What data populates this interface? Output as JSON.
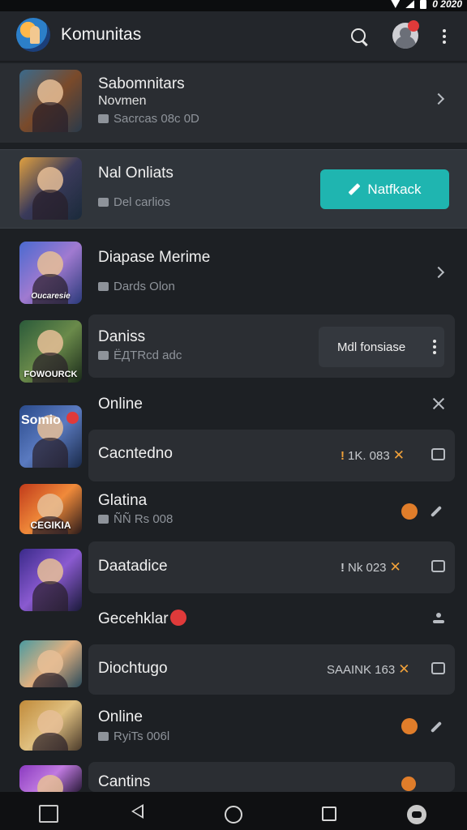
{
  "status_bar": {
    "time": "0 2020"
  },
  "header": {
    "title": "Komunitas"
  },
  "rows": [
    {
      "title": "Sabomnitars",
      "subtitle": "Novmen",
      "meta": "Sacrcas 08c 0D",
      "thumb_label": ""
    },
    {
      "title": "Nal Onliats",
      "meta": "Del carlios",
      "button_label": "Natfkack",
      "thumb_label": ""
    },
    {
      "title": "Diapase Merime",
      "meta": "Dards Olon",
      "thumb_label": "Oucaresie"
    },
    {
      "title": "Daniss",
      "meta": "ЁДTRcd adc",
      "button_label": "Mdl fonsiase",
      "thumb_label": "FOWOURCK"
    },
    {
      "section_title": "Online",
      "title": "Cacntedno",
      "stat": "1K. 083",
      "thumb_label": "Somio"
    },
    {
      "title": "Glatina",
      "meta": "ÑÑ Rs 008",
      "thumb_label": "CEGIKIA"
    },
    {
      "title": "Daatadice",
      "stat": "Nk 023",
      "thumb_label": ""
    },
    {
      "section_title": "Gecehklar"
    },
    {
      "title": "Diochtugo",
      "stat": "SAAINK 163",
      "thumb_label": ""
    },
    {
      "title": "Online",
      "meta": "RyiTs 006l",
      "thumb_label": ""
    },
    {
      "title": "Cantins",
      "thumb_label": ""
    }
  ],
  "colors": {
    "background": "#1d2024",
    "header_bg": "#23262b",
    "accent_teal": "#1fb5b0",
    "star_orange": "#f0a13a",
    "badge_red": "#e03a3a"
  },
  "icons": [
    "search-icon",
    "avatar",
    "more-vert-icon",
    "chevron-right-icon",
    "close-icon",
    "star-icon",
    "back-icon",
    "home-icon",
    "recents-icon"
  ]
}
